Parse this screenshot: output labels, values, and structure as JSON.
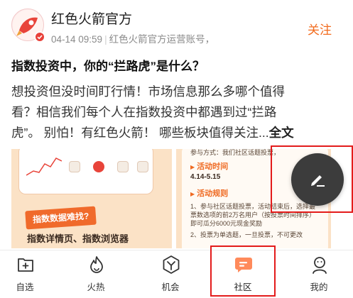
{
  "post": {
    "author": "红色火箭官方",
    "date": "04-14 09:59",
    "account_label": "红色火箭官方运营账号，",
    "follow_label": "关注",
    "title": "指数投资中，你的“拦路虎”是什么？",
    "body_lines": [
      "想投资但没时间盯行情！市场信息那么多哪个值得",
      "看？相信我们每个人在指数投资中都遇到过“拦路",
      "虎”。 别怕！有红色火箭！ 哪些板块值得关注..."
    ],
    "read_more": "全文"
  },
  "images": {
    "left": {
      "banner": "指数数据难找?",
      "subtitle": "指数详情页、指数浏览器"
    },
    "right": {
      "top_text": "参与方式：我们社区话题投票，",
      "activity_time_heading": "活动时间",
      "activity_dates": "4.14-5.15",
      "rules_heading": "活动规则",
      "rule_1": "1、参与社区话题投票，活动结束后，选择最",
      "rule_1b": "票数选项的前2万名用户（按投票时间排序）",
      "rule_1c": "即可瓜分6000元现金奖励",
      "rule_2": "2、投票为单选题，一旦投票，不可更改"
    }
  },
  "tabs": [
    {
      "label": "自选",
      "icon": "add-folder-icon"
    },
    {
      "label": "火热",
      "icon": "flame-icon"
    },
    {
      "label": "机会",
      "icon": "hexagon-y-icon"
    },
    {
      "label": "社区",
      "icon": "chat-bubble-icon",
      "active": true
    },
    {
      "label": "我的",
      "icon": "profile-icon"
    }
  ],
  "colors": {
    "accent": "#f26b1d",
    "highlight": "#e31b1b",
    "compose_bg": "#3c3c3c",
    "tab_active": "#ff8a5b"
  }
}
